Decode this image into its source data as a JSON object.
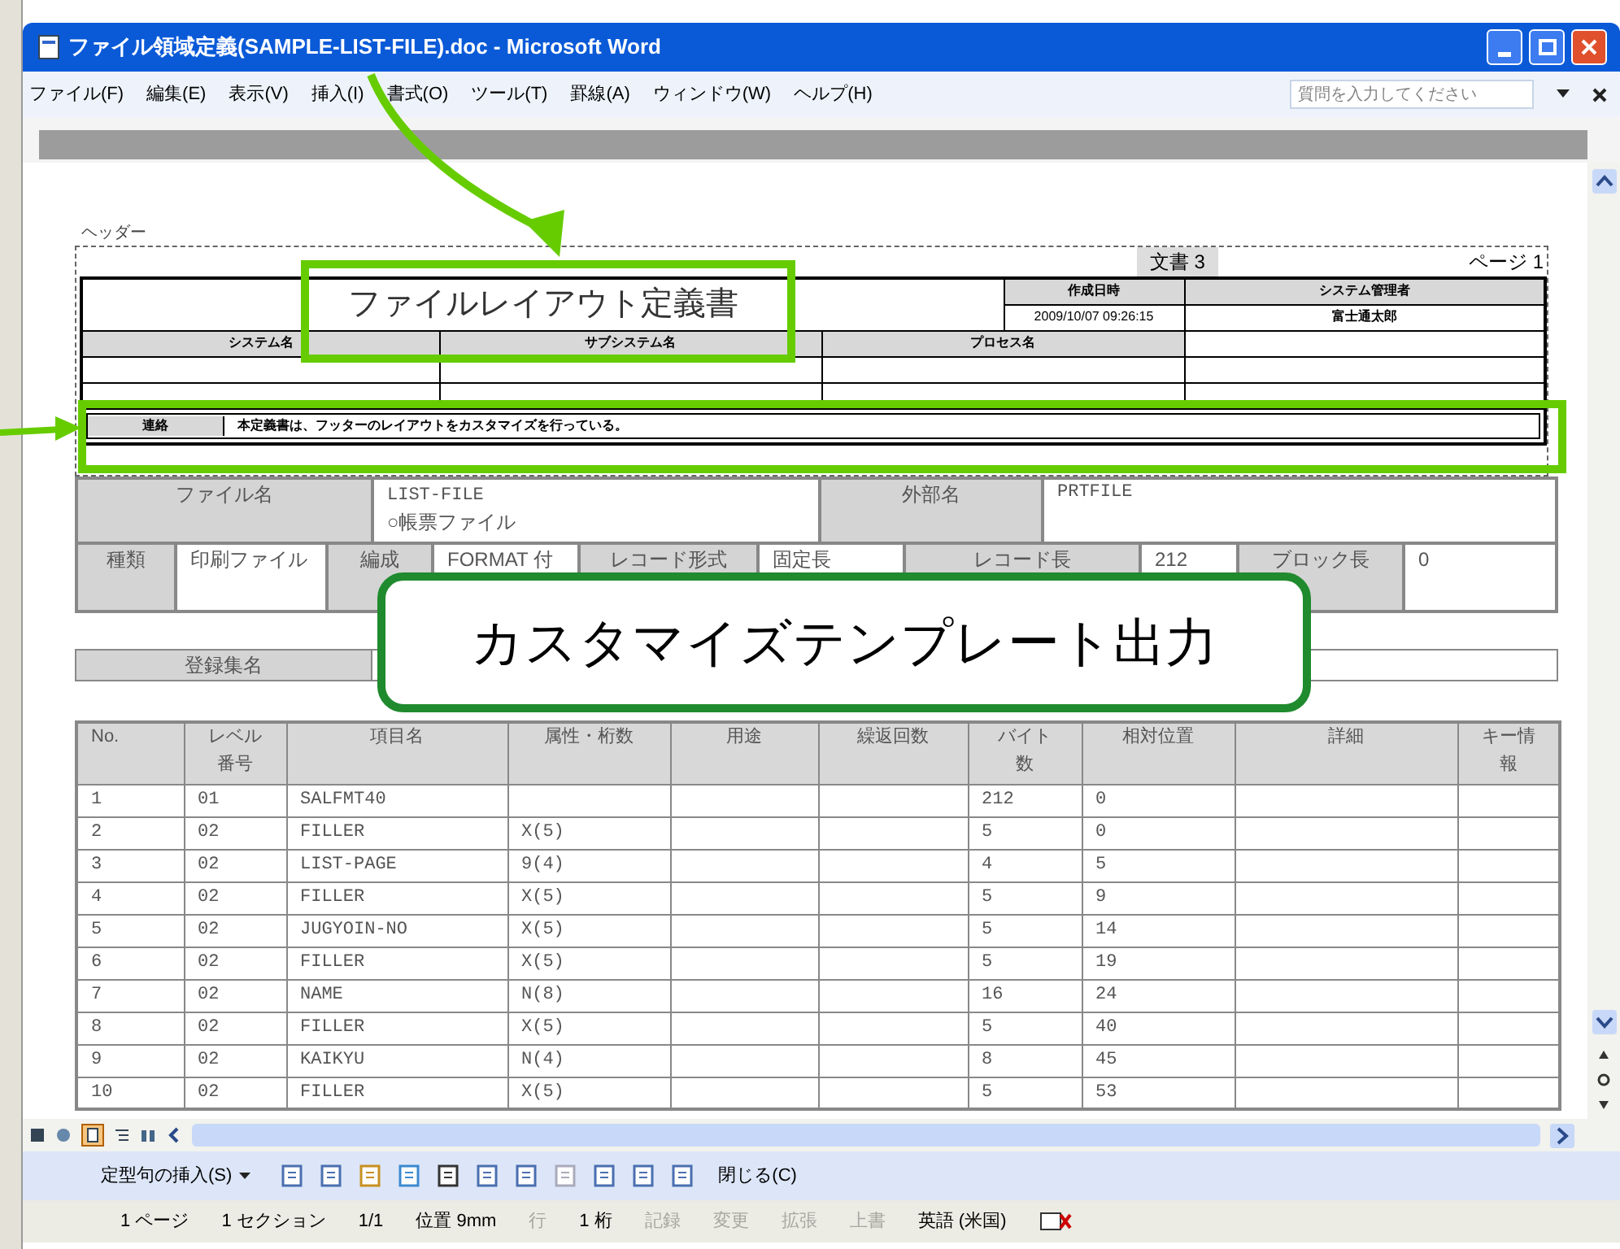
{
  "window": {
    "title": "ファイル領域定義(SAMPLE-LIST-FILE).doc - Microsoft Word",
    "menu": [
      "ファイル(F)",
      "編集(E)",
      "表示(V)",
      "挿入(I)",
      "書式(O)",
      "ツール(T)",
      "罫線(A)",
      "ウィンドウ(W)",
      "ヘルプ(H)"
    ],
    "help_placeholder": "質問を入力してください"
  },
  "header": {
    "label": "ヘッダー",
    "doc_number": "文書 3",
    "page": "ページ 1",
    "title": "ファイルレイアウト定義書",
    "created_label": "作成日時",
    "created": "2009/10/07 09:26:15",
    "admin_label": "システム管理者",
    "admin": "富士通太郎",
    "system_label": "システム名",
    "subsystem_label": "サブシステム名",
    "process_label": "プロセス名",
    "note_label": "連絡",
    "note": "本定義書は、フッターのレイアウトをカスタマイズを行っている。"
  },
  "file_info": {
    "file_name_label": "ファイル名",
    "file_name": [
      "LIST-FILE",
      "○帳票ファイル"
    ],
    "external_label": "外部名",
    "external": "PRTFILE",
    "row_2": [
      {
        "kind": "label",
        "text": "種類"
      },
      {
        "kind": "value",
        "text": "印刷ファイル"
      },
      {
        "kind": "label",
        "text": "編成"
      },
      {
        "kind": "value",
        "text": "FORMAT 付"
      },
      {
        "kind": "label",
        "text": "レコード形式"
      },
      {
        "kind": "value",
        "text": "固定長"
      },
      {
        "kind": "label",
        "text": "レコード長"
      },
      {
        "kind": "value",
        "text": "212"
      },
      {
        "kind": "label",
        "text": "ブロック長"
      },
      {
        "kind": "value",
        "text": "0"
      }
    ],
    "registry_label": "登録集名"
  },
  "table": {
    "columns": [
      "No.",
      "レベル番号",
      "項目名",
      "属性・桁数",
      "用途",
      "繰返回数",
      "バイト数",
      "相対位置",
      "詳細",
      "キー情報"
    ],
    "rows": [
      [
        "1",
        "01",
        "SALFMT40",
        "",
        "",
        "",
        "212",
        "0",
        "",
        ""
      ],
      [
        "2",
        "02",
        "FILLER",
        "X(5)",
        "",
        "",
        "5",
        "0",
        "",
        ""
      ],
      [
        "3",
        "02",
        "LIST-PAGE",
        "9(4)",
        "",
        "",
        "4",
        "5",
        "",
        ""
      ],
      [
        "4",
        "02",
        "FILLER",
        "X(5)",
        "",
        "",
        "5",
        "9",
        "",
        ""
      ],
      [
        "5",
        "02",
        "JUGYOIN-NO",
        "X(5)",
        "",
        "",
        "5",
        "14",
        "",
        ""
      ],
      [
        "6",
        "02",
        "FILLER",
        "X(5)",
        "",
        "",
        "5",
        "19",
        "",
        ""
      ],
      [
        "7",
        "02",
        "NAME",
        "N(8)",
        "",
        "",
        "16",
        "24",
        "",
        ""
      ],
      [
        "8",
        "02",
        "FILLER",
        "X(5)",
        "",
        "",
        "5",
        "40",
        "",
        ""
      ],
      [
        "9",
        "02",
        "KAIKYU",
        "N(4)",
        "",
        "",
        "8",
        "45",
        "",
        ""
      ],
      [
        "10",
        "02",
        "FILLER",
        "X(5)",
        "",
        "",
        "5",
        "53",
        "",
        ""
      ]
    ]
  },
  "callout": "カスタマイズテンプレート出力",
  "toolbar": {
    "autotext": "定型句の挿入(S)",
    "close": "閉じる(C)"
  },
  "status_bar": [
    {
      "text": "1 ページ",
      "disabled": false
    },
    {
      "text": "1 セクション",
      "disabled": false
    },
    {
      "text": "1/1",
      "disabled": false
    },
    {
      "text": "位置 9mm",
      "disabled": false
    },
    {
      "text": "行",
      "disabled": true
    },
    {
      "text": "1 桁",
      "disabled": false
    },
    {
      "text": "記録",
      "disabled": true
    },
    {
      "text": "変更",
      "disabled": true
    },
    {
      "text": "拡張",
      "disabled": true
    },
    {
      "text": "上書",
      "disabled": true
    },
    {
      "text": "英語 (米国)",
      "disabled": false
    }
  ]
}
